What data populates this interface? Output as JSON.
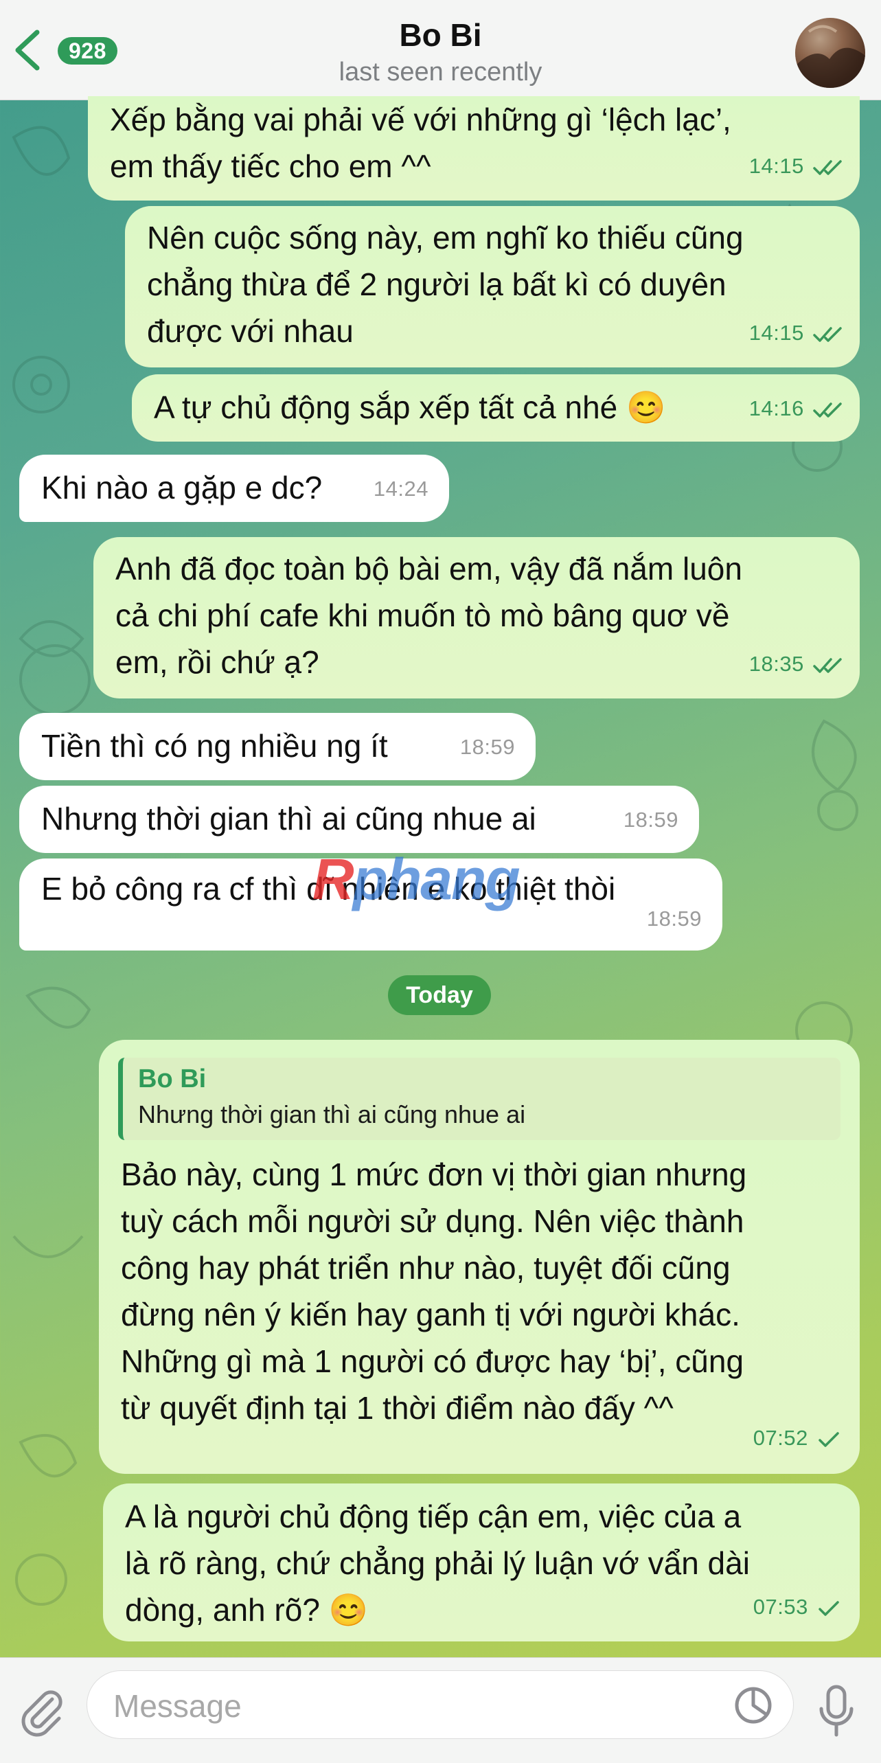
{
  "header": {
    "back_count": "928",
    "title": "Bo Bi",
    "subtitle": "last seen recently"
  },
  "messages": [
    {
      "dir": "out",
      "text": "Xếp bằng vai phải vế với những gì ‘lệch lạc’,\nem thấy tiếc cho em ^^",
      "time": "14:15",
      "status": "read"
    },
    {
      "dir": "out",
      "text": "Nên cuộc sống này, em nghĩ ko thiếu cũng\nchẳng thừa để 2 người lạ bất kì có duyên\nđược với nhau",
      "time": "14:15",
      "status": "read"
    },
    {
      "dir": "out",
      "text": "A tự chủ động sắp xếp tất cả nhé 😊",
      "time": "14:16",
      "status": "read"
    },
    {
      "dir": "in",
      "text": "Khi nào a gặp e dc?",
      "time": "14:24"
    },
    {
      "dir": "out",
      "text": "Anh đã đọc toàn bộ bài em, vậy đã nắm luôn\ncả chi phí cafe khi muốn tò mò bâng quơ về\nem, rồi chứ ạ?",
      "time": "18:35",
      "status": "read"
    },
    {
      "dir": "in",
      "text": "Tiền thì có ng nhiều ng ít",
      "time": "18:59"
    },
    {
      "dir": "in",
      "text": "Nhưng thời gian thì ai cũng nhue ai",
      "time": "18:59"
    },
    {
      "dir": "in",
      "text": "E bỏ công ra cf thì dĩ nhiên e ko thiệt thòi",
      "time": "18:59"
    },
    {
      "dir": "out",
      "text": "Bảo này, cùng 1 mức đơn vị thời gian nhưng\ntuỳ cách mỗi người sử dụng. Nên việc thành\ncông hay phát triển như nào, tuyệt đối cũng\nđừng nên ý kiến hay ganh tị với người khác.\nNhững gì mà 1 người có được hay ‘bị’, cũng\ntừ quyết định tại 1 thời điểm nào đấy ^^",
      "time": "07:52",
      "status": "sent",
      "reply": {
        "name": "Bo Bi",
        "text": "Nhưng thời gian thì ai cũng nhue ai"
      }
    },
    {
      "dir": "out",
      "text": "A là người chủ động tiếp cận em, việc của a\nlà rõ ràng, chứ chẳng phải lý luận vớ vẩn dài\ndòng, anh rõ? 😊",
      "time": "07:53",
      "status": "sent"
    }
  ],
  "date_divider": "Today",
  "watermark": {
    "r": "R",
    "rest": "phang"
  },
  "composer": {
    "placeholder": "Message"
  },
  "colors": {
    "accent": "#2f9b59",
    "outgoing_bubble": "#dcf8c6",
    "incoming_bubble": "#ffffff"
  }
}
